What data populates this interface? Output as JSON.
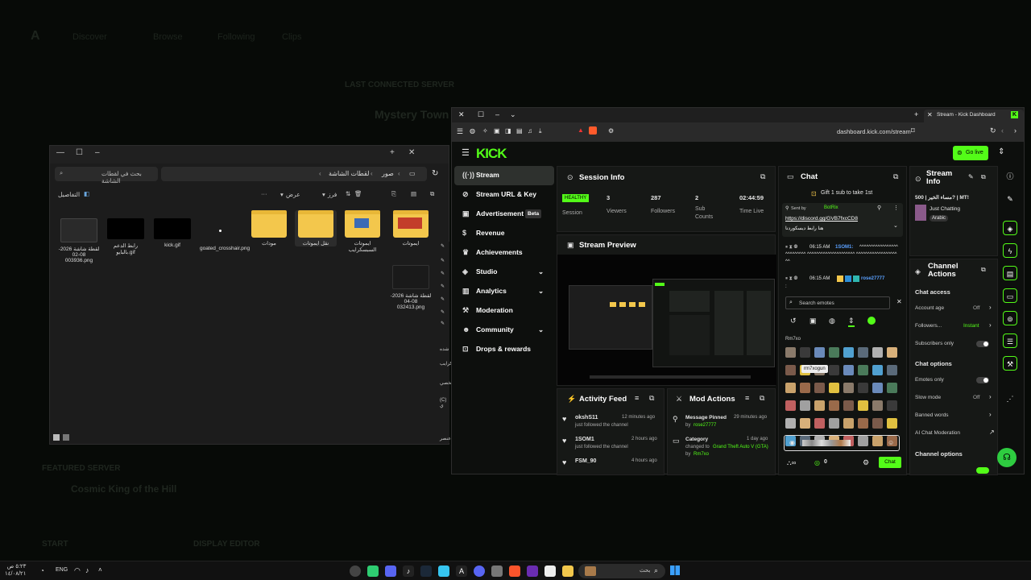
{
  "background_page": {
    "nav": [
      "Discover",
      "Browse",
      "Following",
      "Clips"
    ],
    "last_connected_label": "LAST CONNECTED SERVER",
    "server_name": "Mystery Town",
    "featured_label": "FEATURED SERVER",
    "featured_name": "Cosmic King of the Hill",
    "start_label": "START",
    "display_editor_label": "DISPLAY EDITOR"
  },
  "explorer": {
    "search_placeholder": "بحث في لقطات الشاشة",
    "breadcrumb": [
      "صور",
      "لقطات الشاشة"
    ],
    "toolbar": {
      "sort": "فرز",
      "view": "عرض",
      "details": "التفاصيل"
    },
    "files": [
      {
        "name": "لقطة شاشة 2026-08-02 003936.png",
        "kind": "screenshot"
      },
      {
        "name": "رابط الدعم بالبايو.gif",
        "kind": "black"
      },
      {
        "name": "kick.gif",
        "kind": "black"
      },
      {
        "name": "goated_crosshair.png",
        "kind": "dot"
      },
      {
        "name": "مودات",
        "kind": "folder"
      },
      {
        "name": "نقل ايموتات",
        "kind": "folder"
      },
      {
        "name": "ايموتات السبسكرايب",
        "kind": "folder"
      },
      {
        "name": "ايموتات",
        "kind": "folder"
      },
      {
        "name": "لقطة شاشة 2026-08-04 032413.png",
        "kind": "screenshot"
      }
    ],
    "side_fragments": [
      "شده",
      "كرايب",
      "شخصي",
      "(C) ي",
      "عنصر"
    ]
  },
  "browser": {
    "tab_title": "Stream - Kick Dashboard",
    "url": "dashboard.kick.com/stream"
  },
  "kick": {
    "logo": "KICK",
    "go_live": "Go live",
    "sidebar": [
      {
        "label": "Stream",
        "icon": "broadcast-icon",
        "active": true
      },
      {
        "label": "Stream URL & Key",
        "icon": "link-icon"
      },
      {
        "label": "Advertisement",
        "icon": "ad-icon",
        "badge": "Beta"
      },
      {
        "label": "Revenue",
        "icon": "dollar-icon"
      },
      {
        "label": "Achievements",
        "icon": "trophy-icon"
      },
      {
        "label": "Studio",
        "icon": "studio-icon",
        "chevron": true
      },
      {
        "label": "Analytics",
        "icon": "chart-icon",
        "chevron": true
      },
      {
        "label": "Moderation",
        "icon": "wrench-icon"
      },
      {
        "label": "Community",
        "icon": "community-icon",
        "chevron": true
      },
      {
        "label": "Drops & rewards",
        "icon": "gift-icon"
      }
    ],
    "session_info": {
      "title": "Session Info",
      "status": "HEALTHY",
      "status_label": "Session",
      "stats": [
        {
          "value": "3",
          "label": "Viewers"
        },
        {
          "value": "287",
          "label": "Followers"
        },
        {
          "value": "2",
          "label": "Sub Counts"
        },
        {
          "value": "02:44:59",
          "label": "Time Live"
        }
      ]
    },
    "stream_preview": {
      "title": "Stream Preview"
    },
    "activity_feed": {
      "title": "Activity Feed",
      "items": [
        {
          "user": "okshS11",
          "action": "just followed the channel",
          "time": "12 minutes ago"
        },
        {
          "user": "1SOM1",
          "action": "just followed the channel",
          "time": "2 hours ago"
        },
        {
          "user": "FSM_90",
          "action": "just followed the channel",
          "time": "4 hours ago"
        }
      ]
    },
    "mod_actions": {
      "title": "Mod Actions",
      "items": [
        {
          "title": "Message Pinned",
          "time": "29 minutes ago",
          "detail_prefix": "by",
          "detail_user": "rose27777"
        },
        {
          "title": "Category",
          "time": "1 day ago",
          "detail_prefix": "changed to",
          "detail_value": "Grand Theft Auto V (GTA)",
          "by": "by",
          "detail_user": "Rm7xo"
        }
      ]
    },
    "chat": {
      "title": "Chat",
      "gift_banner": "Gift 1 sub to take 1st",
      "pinned_sent_by": "Sent by",
      "pinned_user": "BotRix",
      "pinned_link": "https://discord.gg/GVB7fxcCD8",
      "pinned_text": "هنا رابط ديسكوردنا",
      "messages": [
        {
          "time": "06:15 AM",
          "user": "1SOM1:",
          "text": "^^^^^^^^^^^^^^^^^^^^^^^^^^ ^^^^^^^^^^^^^^^^^^^^^ ^^^^^^^^^^^^^^^^^^^^"
        },
        {
          "time": "06:15 AM",
          "user": "rose27777",
          "text": ":"
        }
      ],
      "emote_search_placeholder": "Search emotes",
      "emote_section": "Rm7xo",
      "tooltip": "rm7xogun",
      "count": "0",
      "chat_button": "Chat"
    },
    "stream_info": {
      "title": "Stream Info",
      "stream_title": "مساء الخير | 500? | MT!",
      "category": "Just Chatting",
      "language": "Arabic"
    },
    "channel_actions": {
      "title": "Channel Actions",
      "chat_access": "Chat access",
      "account_age": {
        "label": "Account age",
        "value": "Off"
      },
      "followers": {
        "label": "Followers...",
        "value": "Instant"
      },
      "subscribers_only": "Subscribers only",
      "chat_options": "Chat options",
      "emotes_only": "Emotes only",
      "slow_mode": {
        "label": "Slow mode",
        "value": "Off"
      },
      "banned_words": "Banned words",
      "ai_moderation": "AI Chat Moderation",
      "channel_options": "Channel options"
    }
  },
  "taskbar": {
    "time": "٥:٢٣ ص",
    "date": "١٤/٠٨/٢١",
    "lang": "ENG",
    "search_placeholder": "بحث"
  },
  "colors": {
    "kick_green": "#53fc18",
    "folder": "#f3c74c"
  }
}
